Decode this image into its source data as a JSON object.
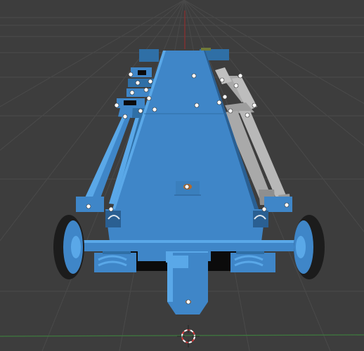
{
  "viewport": {
    "background": "#3d3d3d",
    "grid_color": "#4a4a4a",
    "axis_x_color": "#7a3a3a",
    "axis_y_color": "#3e7a3e",
    "axis_z_color": "#8a2f2f"
  },
  "model": {
    "main_color": "#3f86c8",
    "highlight_color": "#5aa8e8",
    "shadow_color": "#2a5f92",
    "dark_color": "#0b0b0b",
    "deselected_part_color": "#a9a9a9",
    "selected_vertex_color": "#ffffff",
    "active_vertex_color": "#f08a2a"
  },
  "cursor": {
    "name": "3d-cursor-icon",
    "ring_colors": [
      "#ffffff",
      "#d83a3a"
    ]
  }
}
